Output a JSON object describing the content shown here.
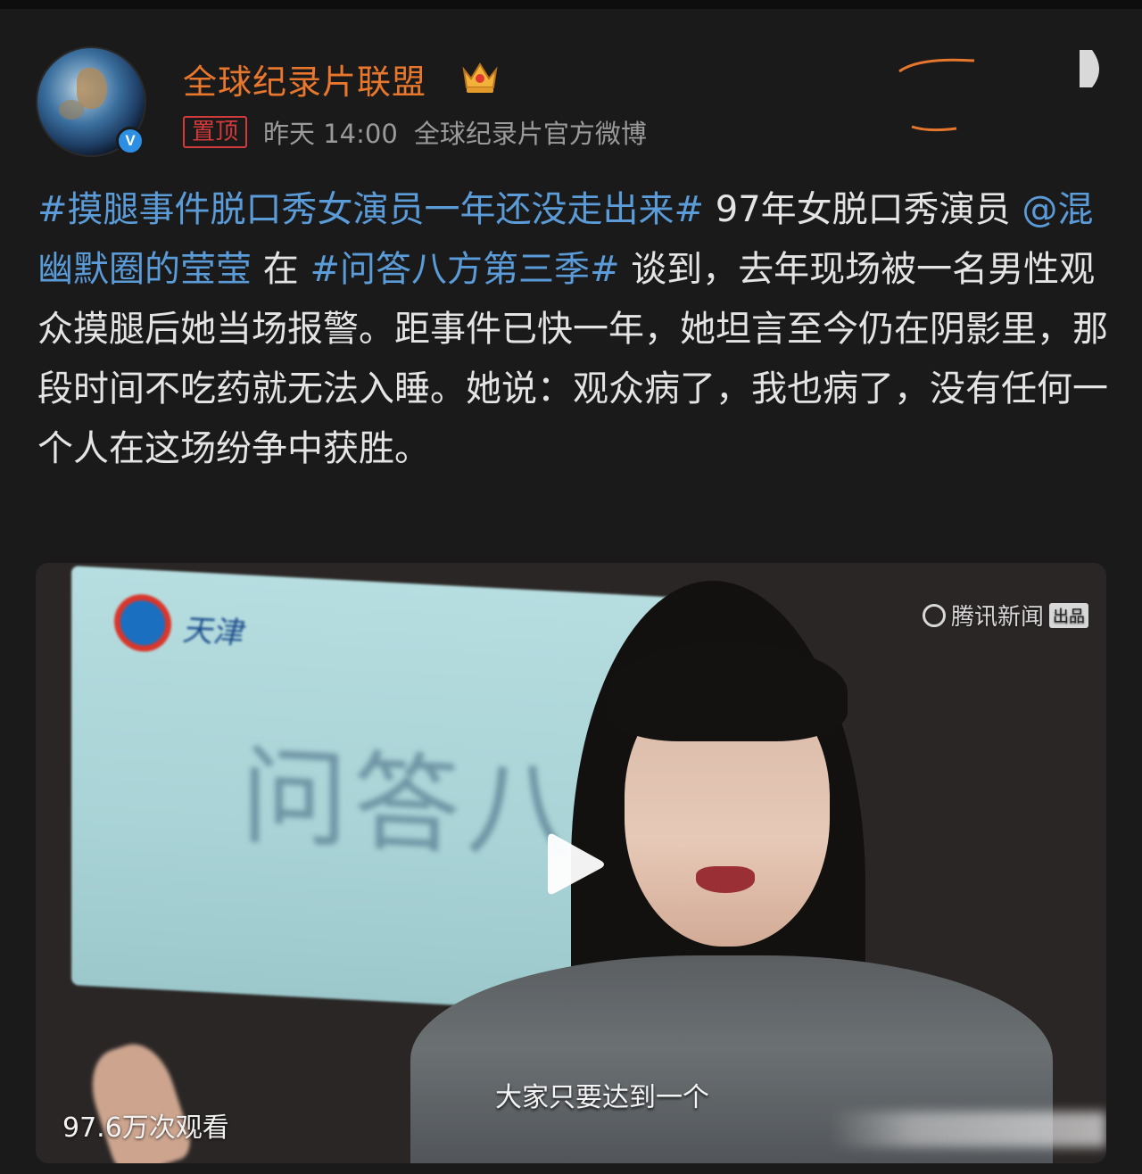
{
  "account": {
    "name": "全球纪录片联盟",
    "pin_label": "置顶",
    "time": "昨天 14:00",
    "source": "全球纪录片官方微博",
    "verified_glyph": "V",
    "name_color": "#e8772e"
  },
  "post": {
    "tag_1": "#摸腿事件脱口秀女演员一年还没走出来#",
    "text_1": " 97年女脱口秀演员 ",
    "mention": "@混幽默圈的莹莹",
    "text_2": " 在 ",
    "tag_2": "#问答八方第三季#",
    "text_3": " 谈到，去年现场被一名男性观众摸腿后她当场报警。距事件已快一年，她坦言至今仍在阴影里，那段时间不吃药就无法入睡。她说：观众病了，我也病了，没有任何一个人在这场纷争中获胜。",
    "link_color": "#5a9bd8"
  },
  "video": {
    "watermark": "腾讯新闻",
    "watermark_tag": "出品",
    "screen_logo_text": "天津",
    "screen_title": "问答八方",
    "subtitle": "大家只要达到一个",
    "view_count": "97.6万次观看"
  }
}
